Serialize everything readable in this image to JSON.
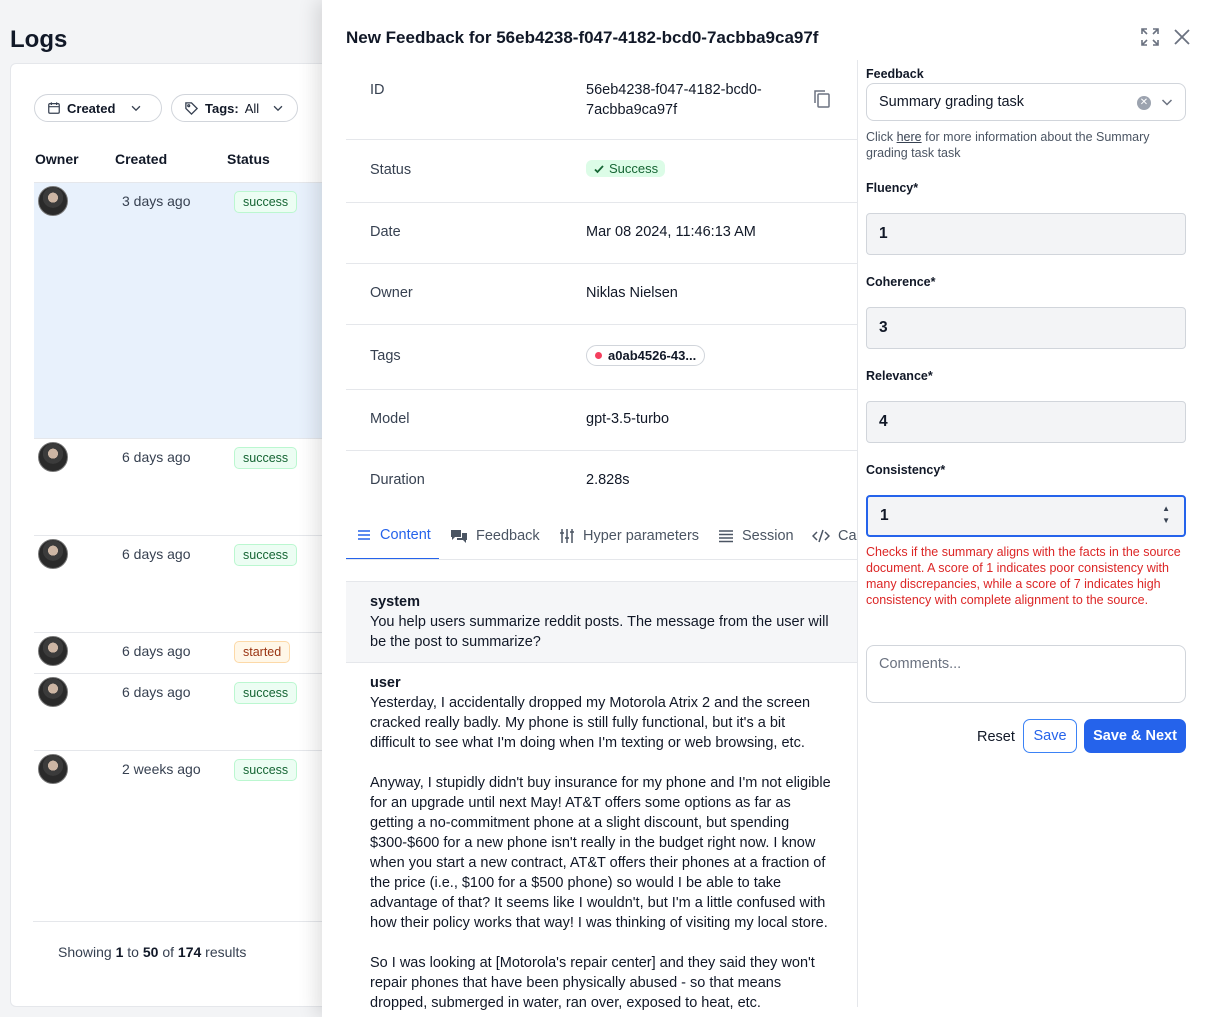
{
  "logs": {
    "title": "Logs",
    "filters": {
      "created_label": "Created",
      "tags_label": "Tags:",
      "tags_value": "All"
    },
    "columns": {
      "owner": "Owner",
      "created": "Created",
      "status": "Status"
    },
    "rows": [
      {
        "created": "3 days ago",
        "status": "success"
      },
      {
        "created": "6 days ago",
        "status": "success"
      },
      {
        "created": "6 days ago",
        "status": "success"
      },
      {
        "created": "6 days ago",
        "status": "started"
      },
      {
        "created": "6 days ago",
        "status": "success"
      },
      {
        "created": "2 weeks ago",
        "status": "success"
      }
    ],
    "pagination": {
      "prefix": "Showing",
      "from": "1",
      "to_word": "to",
      "to": "50",
      "of_word": "of",
      "total": "174",
      "suffix": "results"
    }
  },
  "drawer": {
    "title": "New Feedback for 56eb4238-f047-4182-bcd0-7acbba9ca97f",
    "details": {
      "id_label": "ID",
      "id_line1": "56eb4238-f047-4182-bcd0-",
      "id_line2": "7acbba9ca97f",
      "status_label": "Status",
      "status_value": "Success",
      "date_label": "Date",
      "date_value": "Mar 08 2024, 11:46:13 AM",
      "owner_label": "Owner",
      "owner_value": "Niklas Nielsen",
      "tags_label": "Tags",
      "tags_value": "a0ab4526-43...",
      "model_label": "Model",
      "model_value": "gpt-3.5-turbo",
      "duration_label": "Duration",
      "duration_value": "2.828s"
    },
    "tabs": [
      "Content",
      "Feedback",
      "Hyper parameters",
      "Session",
      "Ca"
    ],
    "messages": {
      "system_role": "system",
      "system_text": "You help users summarize reddit posts. The message from the user will be the post to summarize?",
      "user_role": "user",
      "user_p1": "Yesterday, I accidentally dropped my Motorola Atrix 2 and the screen cracked really badly. My phone is still fully functional, but it's a bit difficult to see what I'm doing when I'm texting or web browsing, etc.",
      "user_p2": "Anyway, I stupidly didn't buy insurance for my phone and I'm not eligible for an upgrade until next May! AT&T offers some options as far as getting a no-commitment phone at a slight discount, but spending $300-$600 for a new phone isn't really in the budget right now. I know when you start a new contract, AT&T offers their phones at a fraction of the price (i.e., $100 for a $500 phone) so would I be able to take advantage of that? It seems like I wouldn't, but I'm a little confused with how their policy works that way! I was thinking of visiting my local store.",
      "user_p3": "So I was looking at [Motorola's repair center] and they said they won't repair phones that have been physically abused - so that means dropped, submerged in water, ran over, exposed to heat, etc."
    }
  },
  "feedback": {
    "label": "Feedback",
    "selected": "Summary grading task",
    "help_prefix": "Click",
    "help_link": "here",
    "help_suffix": "for more information about the Summary grading task task",
    "scores": [
      {
        "label": "Fluency*",
        "value": "1"
      },
      {
        "label": "Coherence*",
        "value": "3"
      },
      {
        "label": "Relevance*",
        "value": "4"
      },
      {
        "label": "Consistency*",
        "value": "1"
      }
    ],
    "error": "Checks if the summary aligns with the facts in the source document. A score of 1 indicates poor consistency with many discrepancies, while a score of 7 indicates high consistency with complete alignment to the source.",
    "comments_placeholder": "Comments...",
    "reset": "Reset",
    "save": "Save",
    "save_next": "Save & Next"
  },
  "colors": {
    "accent": "#2563eb",
    "success_bg": "#dcfce7",
    "error": "#dc2626",
    "selected_row": "#e8f1fc"
  }
}
